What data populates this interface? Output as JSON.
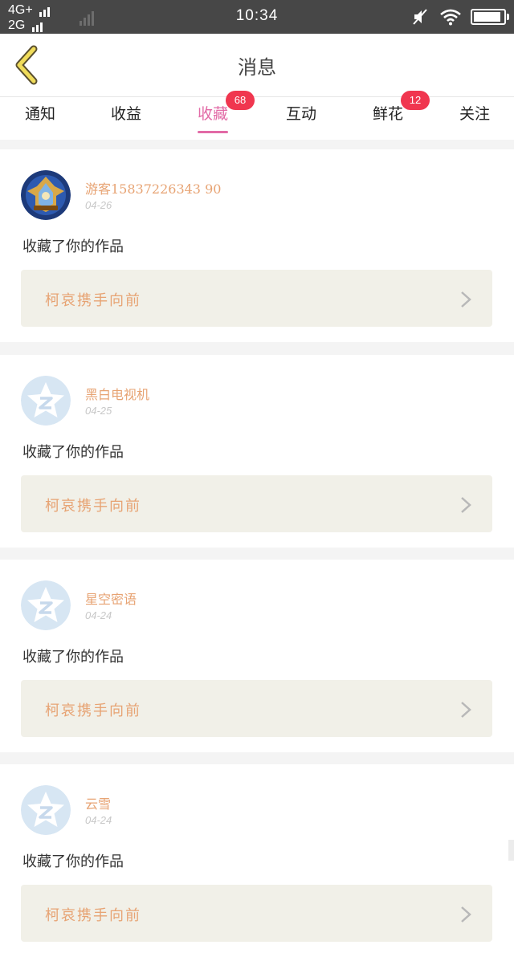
{
  "status_bar": {
    "network_1": "4G+",
    "network_2": "2G",
    "time": "10:34",
    "battery_level": 0.92
  },
  "nav": {
    "title": "消息",
    "back_icon": "chevron-left-icon"
  },
  "tabs": [
    {
      "label": "通知",
      "badge": null,
      "active": false
    },
    {
      "label": "收益",
      "badge": null,
      "active": false
    },
    {
      "label": "收藏",
      "badge": "68",
      "active": true
    },
    {
      "label": "互动",
      "badge": null,
      "active": false
    },
    {
      "label": "鲜花",
      "badge": "12",
      "active": false
    },
    {
      "label": "关注",
      "badge": null,
      "active": false
    }
  ],
  "messages": [
    {
      "user": "游客15837226343 90",
      "date": "04-26",
      "action": "收藏了你的作品",
      "work": "柯哀携手向前",
      "avatar": "game-emblem-avatar"
    },
    {
      "user": "黑白电视机",
      "date": "04-25",
      "action": "收藏了你的作品",
      "work": "柯哀携手向前",
      "avatar": "default-star-avatar"
    },
    {
      "user": "星空密语",
      "date": "04-24",
      "action": "收藏了你的作品",
      "work": "柯哀携手向前",
      "avatar": "default-star-avatar"
    },
    {
      "user": "云雪",
      "date": "04-24",
      "action": "收藏了你的作品",
      "work": "柯哀携手向前",
      "avatar": "default-star-avatar"
    }
  ],
  "colors": {
    "accent": "#e26aa6",
    "badge": "#f0364f",
    "username": "#e7a373",
    "work_box_bg": "#f1f0e8",
    "divider": "#f4f4f4",
    "back_arrow": "#f0dc5a"
  }
}
